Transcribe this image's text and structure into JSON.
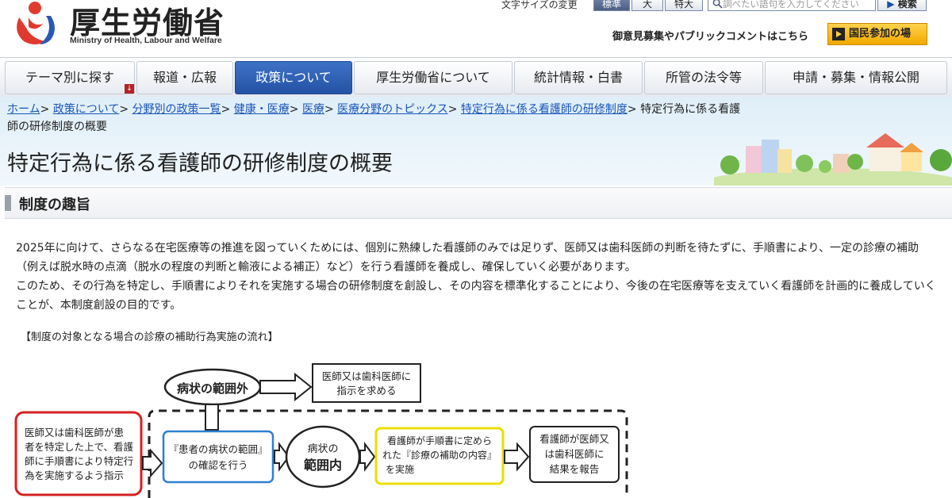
{
  "header": {
    "logo_jp": "厚生労働省",
    "logo_en": "Ministry of Health, Labour and Welfare",
    "text_size_label": "文字サイズの変更",
    "text_size_options": [
      "標準",
      "大",
      "特大"
    ],
    "search_placeholder": "調べたい語句を入力してください",
    "search_button": "検索",
    "opinion_link": "御意見募集やパブリックコメントはこちら",
    "participation_button": "国民参加の場"
  },
  "nav": {
    "items": [
      "テーマ別に探す",
      "報道・広報",
      "政策について",
      "厚生労働省について",
      "統計情報・白書",
      "所管の法令等",
      "申請・募集・情報公開"
    ],
    "active_index": 2
  },
  "breadcrumb": {
    "links": [
      "ホーム",
      "政策について",
      "分野別の政策一覧",
      "健康・医療",
      "医療",
      "医療分野のトピックス",
      "特定行為に係る看護師の研修制度"
    ],
    "separator": ">",
    "current": "特定行為に係る看護師の研修制度の概要"
  },
  "page": {
    "title": "特定行為に係る看護師の研修制度の概要"
  },
  "section": {
    "title": "制度の趣旨",
    "paragraph1": "2025年に向けて、さらなる在宅医療等の推進を図っていくためには、個別に熟練した看護師のみでは足りず、医師又は歯科医師の判断を待たずに、手順書により、一定の診療の補助（例えば脱水時の点滴（脱水の程度の判断と輸液による補正）など）を行う看護師を養成し、確保していく必要があります。",
    "paragraph2": "このため、その行為を特定し、手順書によりそれを実施する場合の研修制度を創設し、その内容を標準化することにより、今後の在宅医療等を支えていく看護師を計画的に養成していくことが、本制度創設の目的です。",
    "flow_caption": "【制度の対象となる場合の診療の補助行為実施の流れ】"
  },
  "flow": {
    "outside_range": "病状の範囲外",
    "outside_result": [
      "医師又は歯科医師に",
      "指示を求める"
    ],
    "start": [
      "医師又は歯科医師が患",
      "者を特定した上で、看護",
      "師に手順書により特定行",
      "為を実施するよう指示"
    ],
    "confirm": [
      "『患者の病状の範囲』",
      "の確認を行う"
    ],
    "inside_range": [
      "病状の",
      "範囲内"
    ],
    "perform": [
      "看護師が手順書に定めら",
      "れた『診療の補助の内容』",
      "を実施"
    ],
    "report": [
      "看護師が医師又",
      "は歯科医師に",
      "結果を報告"
    ]
  },
  "colors": {
    "nav_active": "#2d5db0",
    "link": "#1a55b9",
    "start_border": "#d62020",
    "confirm_border": "#2f7fd0",
    "perform_border": "#e8e000",
    "participation_button": "#f5b400"
  }
}
